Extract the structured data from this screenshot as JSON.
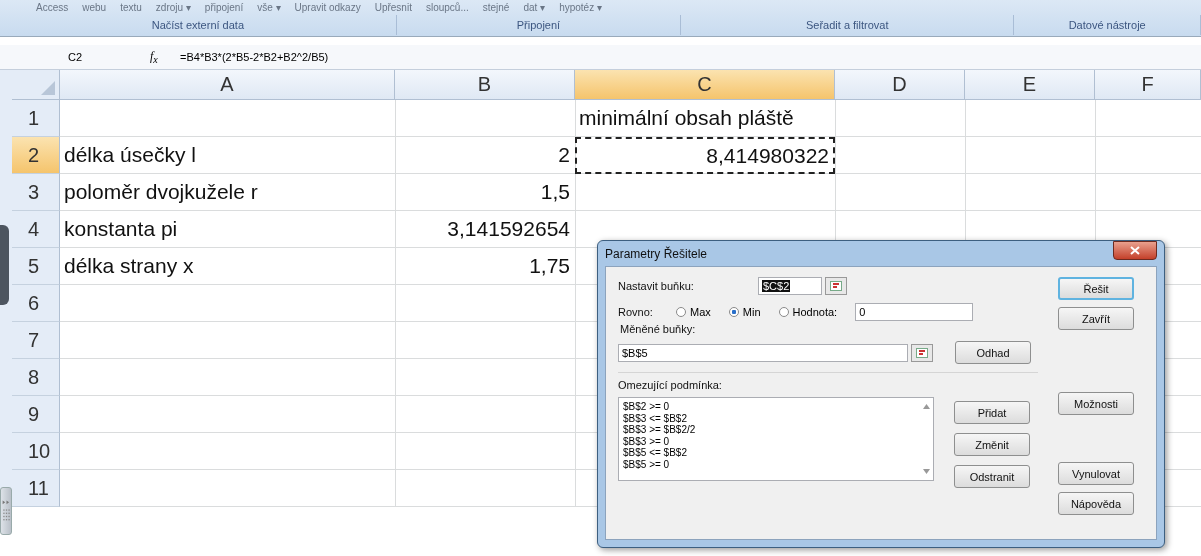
{
  "ribbon": {
    "commands": [
      "Access",
      "webu",
      "textu",
      "zdroju ▾",
      "připojení",
      "vše ▾",
      "Upravit odkazy",
      "Upřesnit",
      "sloupců...",
      "stejné",
      "dat ▾",
      "hypotéz ▾"
    ],
    "groups": [
      "Načíst externí data",
      "Připojení",
      "Seřadit a filtrovat",
      "Datové nástroje"
    ]
  },
  "formula_bar": {
    "cell_ref": "C2",
    "function_label": "f$_{x}$",
    "formula": "=B4*B3*(2*B5-2*B2+B2^2/B5)"
  },
  "columns": [
    {
      "label": "A",
      "selected": false
    },
    {
      "label": "B",
      "selected": false
    },
    {
      "label": "C",
      "selected": true
    },
    {
      "label": "D",
      "selected": false
    },
    {
      "label": "E",
      "selected": false
    },
    {
      "label": "F",
      "selected": false
    }
  ],
  "rows": [
    {
      "number": "1",
      "selected": false,
      "cells": [
        null,
        null,
        {
          "text": "minimální obsah pláště",
          "kind": "text",
          "marquee": false
        },
        null,
        null,
        null
      ]
    },
    {
      "number": "2",
      "selected": true,
      "cells": [
        {
          "text": "délka úsečky l",
          "kind": "text",
          "marquee": false
        },
        {
          "text": "2",
          "kind": "number",
          "marquee": false
        },
        {
          "text": "8,414980322",
          "kind": "number",
          "marquee": true
        },
        null,
        null,
        null
      ]
    },
    {
      "number": "3",
      "selected": false,
      "cells": [
        {
          "text": "poloměr dvojkužele r",
          "kind": "text",
          "marquee": false
        },
        {
          "text": "1,5",
          "kind": "number",
          "marquee": false
        },
        null,
        null,
        null,
        null
      ]
    },
    {
      "number": "4",
      "selected": false,
      "cells": [
        {
          "text": "konstanta pi",
          "kind": "text",
          "marquee": false
        },
        {
          "text": "3,141592654",
          "kind": "number",
          "marquee": false
        },
        null,
        null,
        null,
        null
      ]
    },
    {
      "number": "5",
      "selected": false,
      "cells": [
        {
          "text": "délka strany x",
          "kind": "text",
          "marquee": false
        },
        {
          "text": "1,75",
          "kind": "number",
          "marquee": false
        },
        null,
        null,
        null,
        null
      ]
    },
    {
      "number": "6",
      "selected": false,
      "cells": [
        null,
        null,
        null,
        null,
        null,
        null
      ]
    },
    {
      "number": "7",
      "selected": false,
      "cells": [
        null,
        null,
        null,
        null,
        null,
        null
      ]
    },
    {
      "number": "8",
      "selected": false,
      "cells": [
        null,
        null,
        null,
        null,
        null,
        null
      ]
    },
    {
      "number": "9",
      "selected": false,
      "cells": [
        null,
        null,
        null,
        null,
        null,
        null
      ]
    },
    {
      "number": "10",
      "selected": false,
      "cells": [
        null,
        null,
        null,
        null,
        null,
        null
      ]
    },
    {
      "number": "11",
      "selected": false,
      "cells": [
        null,
        null,
        null,
        null,
        null,
        null
      ]
    }
  ],
  "dialog": {
    "title": "Parametry Řešitele",
    "target_cell": {
      "label": "Nastavit buňku:",
      "value": "$C$2"
    },
    "equal_to": {
      "label": "Rovno:",
      "options": [
        {
          "label": "Max",
          "selected": false
        },
        {
          "label": "Min",
          "selected": true
        },
        {
          "label": "Hodnota:",
          "selected": false
        }
      ],
      "value": "0"
    },
    "changing_cells": {
      "label": "Měněné buňky:",
      "value": "$B$5",
      "button": "Odhad"
    },
    "constraints": {
      "label": "Omezující podmínka:",
      "items": [
        "$B$2 >= 0",
        "$B$3 <= $B$2",
        "$B$3 >= $B$2/2",
        "$B$3 >= 0",
        "$B$5 <= $B$2",
        "$B$5 >= 0"
      ],
      "buttons": [
        "Přidat",
        "Změnit",
        "Odstranit"
      ]
    },
    "side_buttons": [
      {
        "label": "Řešit",
        "default": true
      },
      {
        "label": "Zavřít",
        "default": false
      },
      {
        "label": "Možnosti",
        "default": false
      },
      {
        "label": "Vynulovat",
        "default": false
      },
      {
        "label": "Nápověda",
        "default": false
      }
    ]
  }
}
